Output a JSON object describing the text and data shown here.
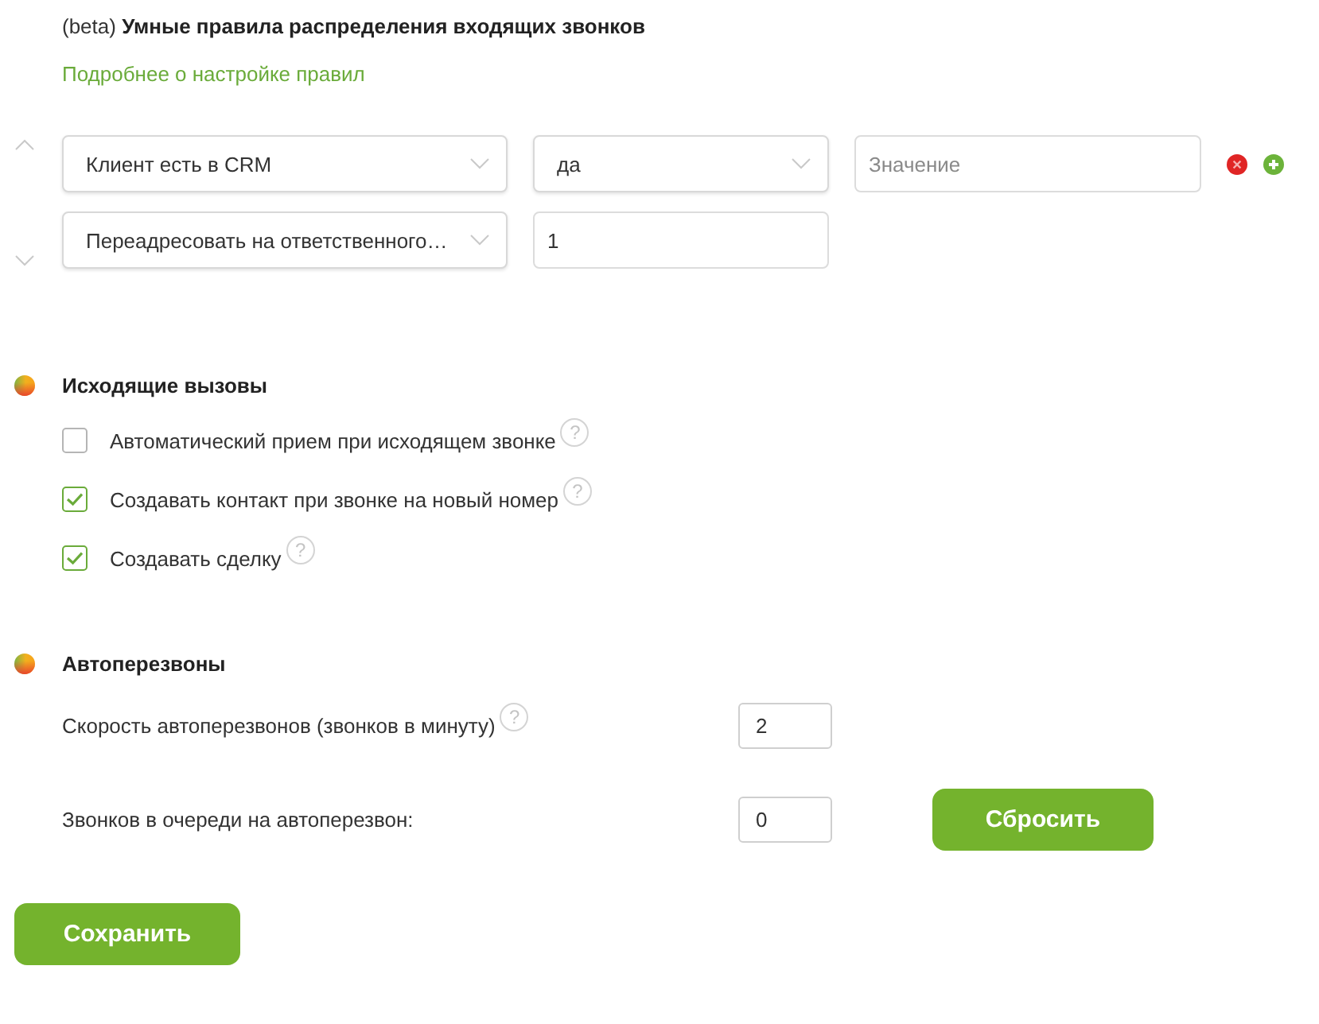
{
  "header": {
    "title": "(beta) **Умные правила распределения входящих звонков**",
    "link": "Подробнее о настройке правил"
  },
  "rule": {
    "conditions": [
      {
        "field": "Клиент есть в CRM",
        "operator": "да",
        "value": {
          "placeholder": "Значение"
        }
      }
    ],
    "actions": [
      {
        "type": "Переадресовать на ответственного…",
        "value": "1"
      }
    ]
  },
  "sections": [
    {
      "title": "Исходящие вызовы",
      "items": [
        {
          "kind": "checkbox",
          "label": "Автоматический прием при исходящем звонке",
          "checked": false,
          "help": "?"
        },
        {
          "kind": "checkbox",
          "label": "Создавать контакт при звонке на новый номер",
          "checked": true,
          "help": "?"
        },
        {
          "kind": "checkbox",
          "label": "Создавать сделку",
          "checked": true,
          "help": "?"
        }
      ]
    },
    {
      "title": "Автоперезвоны",
      "items": [
        {
          "kind": "number",
          "label": "Скорость автоперезвонов (звонков в минуту)",
          "value": "2",
          "help": "?"
        },
        {
          "kind": "number",
          "label": "Звонков в очереди на автоперезвон:",
          "value": "0",
          "button": "Сбросить"
        }
      ]
    }
  ],
  "save_button": "Сохранить"
}
